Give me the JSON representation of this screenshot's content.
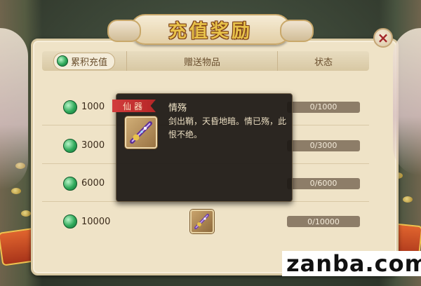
{
  "title": "充值奖励",
  "close_label": "×",
  "header": {
    "col1": "累积充值",
    "col2": "赠送物品",
    "col3": "状态"
  },
  "rows": [
    {
      "amount": "1000",
      "status": "0/1000"
    },
    {
      "amount": "3000",
      "status": "0/3000"
    },
    {
      "amount": "6000",
      "status": "0/6000"
    },
    {
      "amount": "10000",
      "status": "0/10000"
    }
  ],
  "tooltip": {
    "tag": "仙器",
    "name": "情殇",
    "description": "剑出鞘，天昏地暗。情已殇，此恨不绝。"
  },
  "watermark": "zanba.com",
  "icons": {
    "currency": "jade-gem-icon",
    "item": "sword-icon",
    "close": "close-icon"
  },
  "colors": {
    "title_gold": "#e8c24a",
    "tag_red": "#d23c3c",
    "close_red": "#a3262a"
  }
}
